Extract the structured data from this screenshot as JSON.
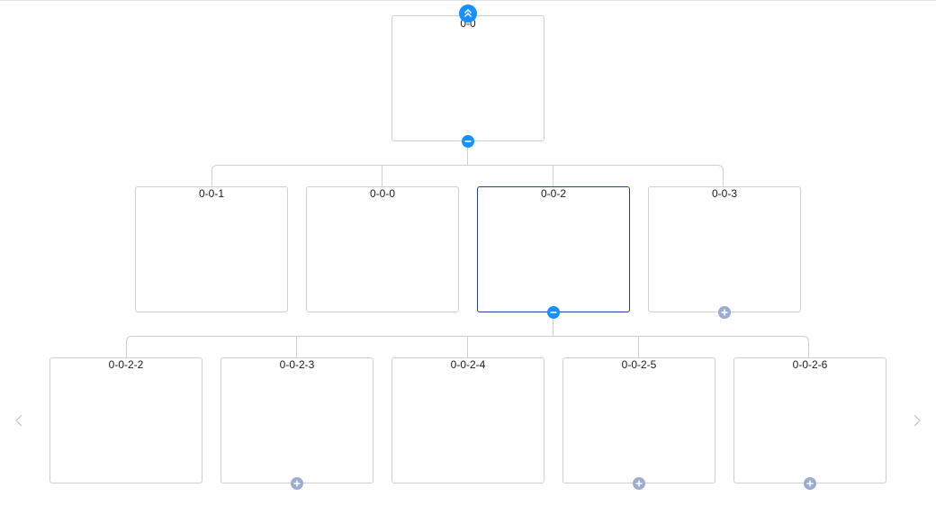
{
  "tree": {
    "root": {
      "label": "0-0"
    },
    "level1": [
      {
        "label": "0-0-1"
      },
      {
        "label": "0-0-0"
      },
      {
        "label": "0-0-2"
      },
      {
        "label": "0-0-3"
      }
    ],
    "level2": [
      {
        "label": "0-0-2-2"
      },
      {
        "label": "0-0-2-3"
      },
      {
        "label": "0-0-2-4"
      },
      {
        "label": "0-0-2-5"
      },
      {
        "label": "0-0-2-6"
      }
    ],
    "selected": "0-0-2"
  },
  "colors": {
    "accent": "#1890ff",
    "collapsed": "#9aaccf",
    "selected_border": "#1f3fa6",
    "border": "#cfcfcf"
  },
  "icons": {
    "collapse_parent": "double-chevron-up-icon",
    "collapse": "minus-circle-icon",
    "expand": "plus-circle-icon",
    "prev": "chevron-left-icon",
    "next": "chevron-right-icon"
  }
}
